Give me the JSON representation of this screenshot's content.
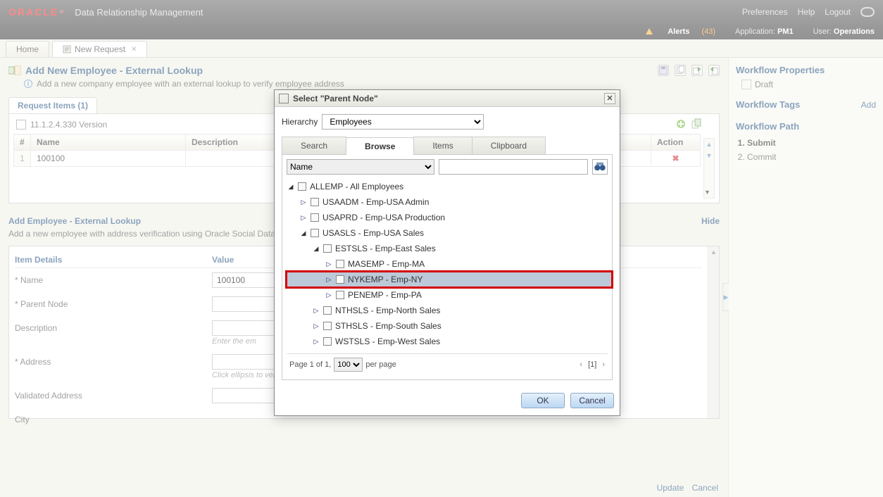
{
  "header": {
    "logo": "ORACLE",
    "product": "Data Relationship Management",
    "links": {
      "prefs": "Preferences",
      "help": "Help",
      "logout": "Logout"
    }
  },
  "subbar": {
    "alerts_label": "Alerts",
    "alerts_count": "(43)",
    "app_label": "Application:",
    "app_value": "PM1",
    "user_label": "User:",
    "user_value": "Operations"
  },
  "tabs": {
    "home": "Home",
    "new_request": "New Request"
  },
  "page": {
    "title": "Add New Employee - External Lookup",
    "desc": "Add a new company employee with an external lookup to verify employee address"
  },
  "request_items": {
    "tab_label": "Request Items (1)",
    "version_label": "11.1.2.4.330 Version",
    "cols": {
      "hash": "#",
      "name": "Name",
      "desc": "Description",
      "action": "Action"
    },
    "rows": [
      {
        "idx": "1",
        "name": "100100",
        "desc": ""
      }
    ]
  },
  "task": {
    "title": "Add Employee - External Lookup",
    "desc": "Add a new employee with address verification using Oracle Social Data a",
    "hide": "Hide"
  },
  "form": {
    "hdr_item": "Item Details",
    "hdr_value": "Value",
    "labels": {
      "name": "* Name",
      "parent": "* Parent Node",
      "desc": "Description",
      "desc_hint": "Enter the em",
      "address": "* Address",
      "address_hint": "Click ellipsis to verify employee address. Select a valid address if multiple exist.",
      "validated": "Validated Address",
      "city": "City"
    },
    "values": {
      "name": "100100"
    }
  },
  "bottom": {
    "update": "Update",
    "cancel": "Cancel"
  },
  "right": {
    "props_title": "Workflow Properties",
    "draft": "Draft",
    "tags_title": "Workflow Tags",
    "add": "Add",
    "path_title": "Workflow Path",
    "steps": [
      "Submit",
      "Commit"
    ]
  },
  "dialog": {
    "title": "Select \"Parent Node\"",
    "hierarchy_label": "Hierarchy",
    "hierarchy_value": "Employees",
    "tabs": {
      "search": "Search",
      "browse": "Browse",
      "items": "Items",
      "clipboard": "Clipboard"
    },
    "search_field": "Name",
    "tree": [
      {
        "depth": 0,
        "state": "open",
        "label": "ALLEMP - All Employees",
        "sel": false,
        "hl": false
      },
      {
        "depth": 1,
        "state": "closed",
        "label": "USAADM - Emp-USA Admin",
        "sel": false,
        "hl": false
      },
      {
        "depth": 1,
        "state": "closed",
        "label": "USAPRD - Emp-USA Production",
        "sel": false,
        "hl": false
      },
      {
        "depth": 1,
        "state": "open",
        "label": "USASLS - Emp-USA Sales",
        "sel": false,
        "hl": false
      },
      {
        "depth": 2,
        "state": "open",
        "label": "ESTSLS - Emp-East Sales",
        "sel": false,
        "hl": false
      },
      {
        "depth": 3,
        "state": "closed",
        "label": "MASEMP - Emp-MA",
        "sel": false,
        "hl": false
      },
      {
        "depth": 3,
        "state": "closed",
        "label": "NYKEMP - Emp-NY",
        "sel": true,
        "hl": true
      },
      {
        "depth": 3,
        "state": "closed",
        "label": "PENEMP - Emp-PA",
        "sel": false,
        "hl": false
      },
      {
        "depth": 2,
        "state": "closed",
        "label": "NTHSLS - Emp-North Sales",
        "sel": false,
        "hl": false
      },
      {
        "depth": 2,
        "state": "closed",
        "label": "STHSLS - Emp-South Sales",
        "sel": false,
        "hl": false
      },
      {
        "depth": 2,
        "state": "closed",
        "label": "WSTSLS - Emp-West Sales",
        "sel": false,
        "hl": false
      }
    ],
    "pager": {
      "page_text": "Page 1 of 1,",
      "per_page_value": "100",
      "per_page_label": "per page",
      "current": "[1]"
    },
    "buttons": {
      "ok": "OK",
      "cancel": "Cancel"
    }
  }
}
